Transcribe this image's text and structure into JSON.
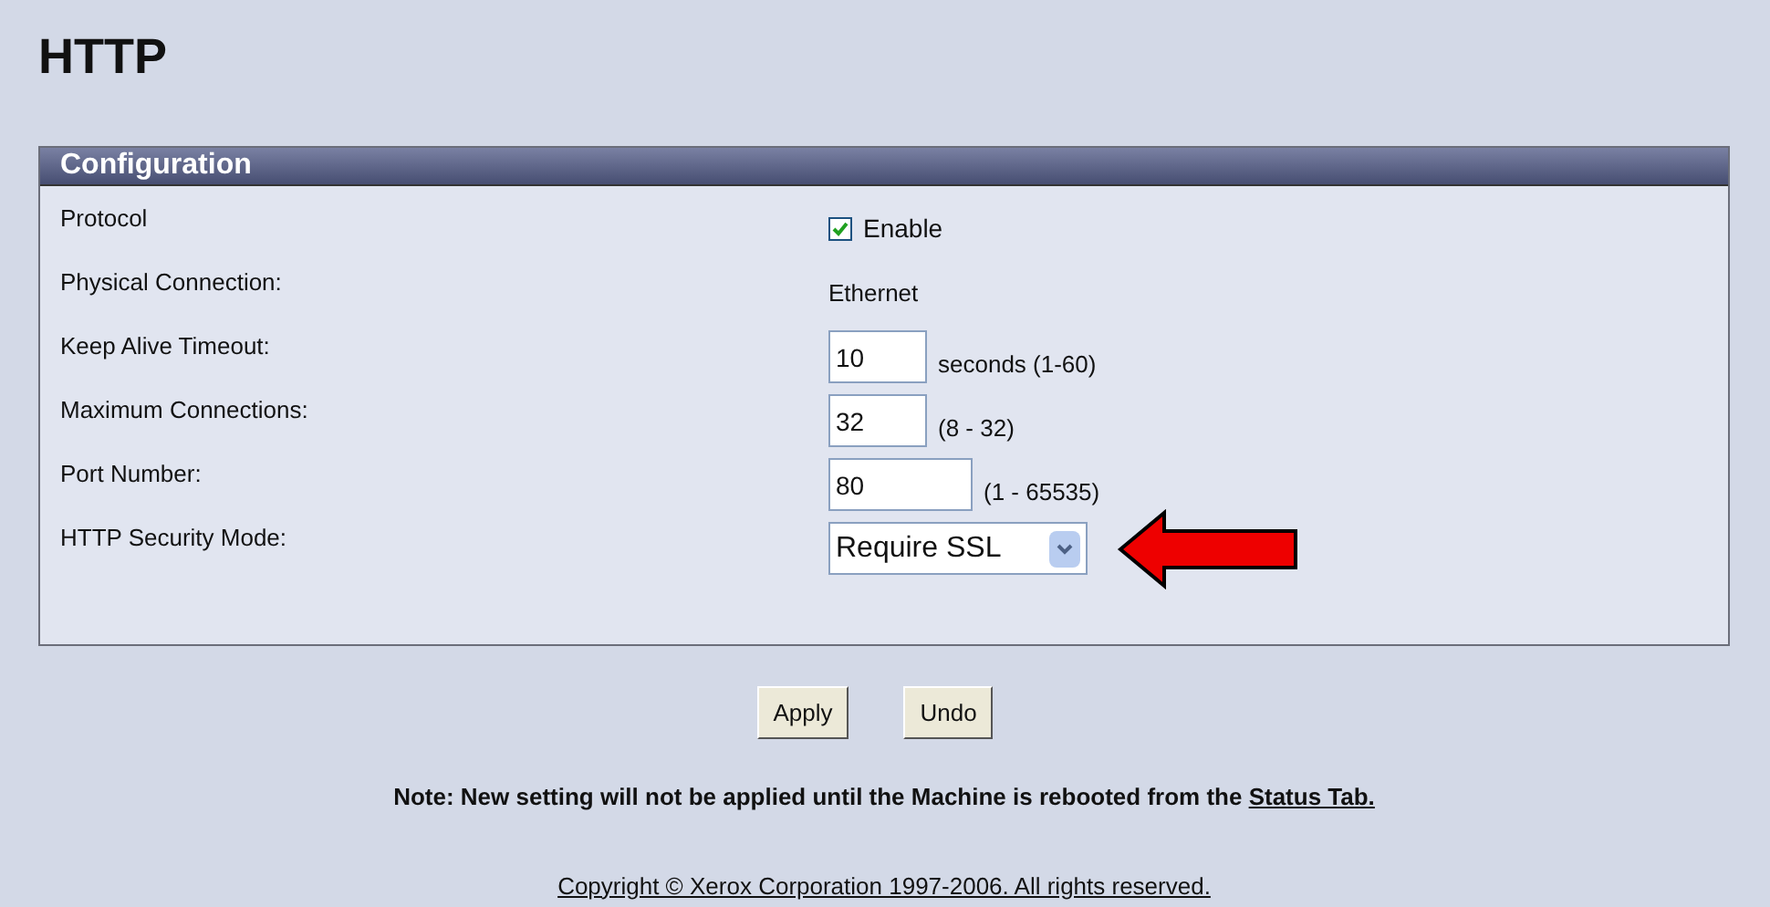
{
  "title": "HTTP",
  "panel": {
    "heading": "Configuration",
    "rows": [
      {
        "label": "Protocol",
        "kind": "checkbox",
        "checked": true,
        "value": "Enable"
      },
      {
        "label": "Physical Connection:",
        "kind": "text",
        "value": "Ethernet"
      },
      {
        "label": "Keep Alive Timeout:",
        "kind": "short_input",
        "value": "10",
        "hint": "seconds (1-60)"
      },
      {
        "label": "Maximum Connections:",
        "kind": "short_input",
        "value": "32",
        "hint": "(8 - 32)"
      },
      {
        "label": "Port Number:",
        "kind": "long_input",
        "value": "80",
        "hint": "(1 - 65535)"
      },
      {
        "label": "HTTP Security Mode:",
        "kind": "select",
        "value": "Require SSL"
      }
    ]
  },
  "buttons": [
    "Apply",
    "Undo"
  ],
  "note": {
    "text": "Note: New setting will not be applied until the Machine is rebooted  from the",
    "link": "Status Tab."
  },
  "copyright": "Copyright © Xerox Corporation 1997-2006. All rights reserved."
}
